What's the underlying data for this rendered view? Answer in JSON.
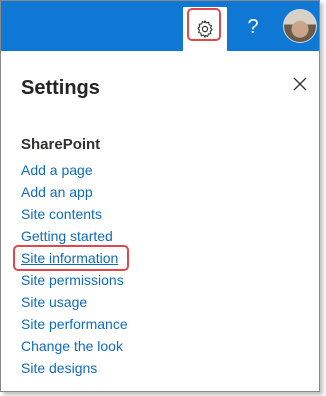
{
  "topbar": {
    "icons": [
      "gear-icon",
      "help-icon",
      "avatar"
    ],
    "help_label": "?"
  },
  "panel": {
    "title": "Settings",
    "section_heading": "SharePoint",
    "links": [
      "Add a page",
      "Add an app",
      "Site contents",
      "Getting started",
      "Site information",
      "Site permissions",
      "Site usage",
      "Site performance",
      "Change the look",
      "Site designs"
    ]
  },
  "colors": {
    "topbar": "#0f78d4",
    "link": "#0f6cbd",
    "highlight": "#e0484e"
  }
}
